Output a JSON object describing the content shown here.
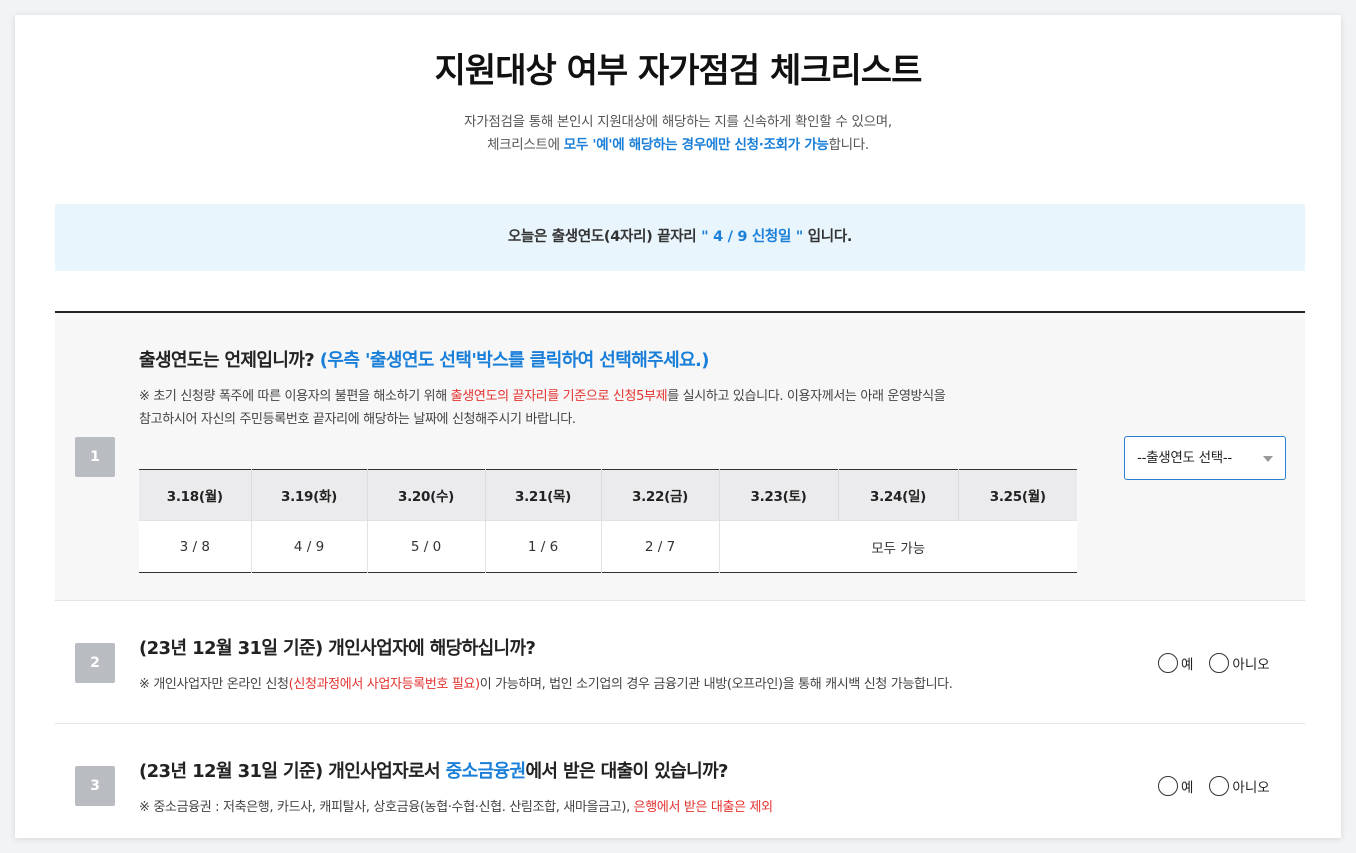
{
  "header": {
    "title": "지원대상 여부 자가점검 체크리스트",
    "subtitle_line1": "자가점검을 통해 본인시 지원대상에 해당하는 지를 신속하게 확인할 수 있으며,",
    "subtitle_line2_prefix": "체크리스트에 ",
    "subtitle_line2_highlight": "모두 '예'에 해당하는 경우에만 신청·조회가 가능",
    "subtitle_line2_suffix": "합니다."
  },
  "notice": {
    "prefix": "오늘은 출생연도(4자리) 끝자리 ",
    "highlight": "\" 4 / 9 신청일 \"",
    "suffix": " 입니다."
  },
  "q1": {
    "number": "1",
    "title": "출생연도는 언제입니까?",
    "hint": "(우측 '출생연도 선택'박스를 클릭하여 선택해주세요.)",
    "desc_prefix": "※  초기 신청량 폭주에 따른 이용자의 불편을 해소하기 위해 ",
    "desc_highlight": "출생연도의 끝자리를 기준으로 신청5부제",
    "desc_suffix": "를 실시하고 있습니다. 이용자께서는 아래 운영방식을",
    "desc_line2": "참고하시어 자신의 주민등록번호 끝자리에 해당하는 날짜에 신청해주시기 바랍니다.",
    "table": {
      "headers": [
        "3.18(월)",
        "3.19(화)",
        "3.20(수)",
        "3.21(목)",
        "3.22(금)",
        "3.23(토)",
        "3.24(일)",
        "3.25(월)"
      ],
      "cells": [
        "3 / 8",
        "4 / 9",
        "5 / 0",
        "1 / 6",
        "2 / 7"
      ],
      "all_available": "모두 가능"
    },
    "select_placeholder": "--출생연도 선택--"
  },
  "q2": {
    "number": "2",
    "title": "(23년 12월 31일 기준) 개인사업자에 해당하십니까?",
    "desc_prefix": "※ 개인사업자만 온라인 신청",
    "desc_highlight": "(신청과정에서 사업자등록번호 필요)",
    "desc_suffix": "이 가능하며, 법인 소기업의 경우 금융기관 내방(오프라인)을 통해 캐시백 신청 가능합니다.",
    "yes": "예",
    "no": "아니오"
  },
  "q3": {
    "number": "3",
    "title_prefix": "(23년 12월 31일 기준) 개인사업자로서 ",
    "title_highlight": "중소금융권",
    "title_suffix": "에서 받은 대출이 있습니까?",
    "desc_prefix": "※ 중소금융권 : 저축은행, 카드사, 캐피탈사, 상호금융(농협·수협·신협. 산림조합, 새마을금고), ",
    "desc_highlight": "은행에서 받은 대출은 제외",
    "yes": "예",
    "no": "아니오"
  },
  "colors": {
    "accent_blue": "#1a7fd8",
    "highlight_red": "#e4332f",
    "notice_bg": "#e9f5fc",
    "number_badge": "#b9bcc1"
  }
}
